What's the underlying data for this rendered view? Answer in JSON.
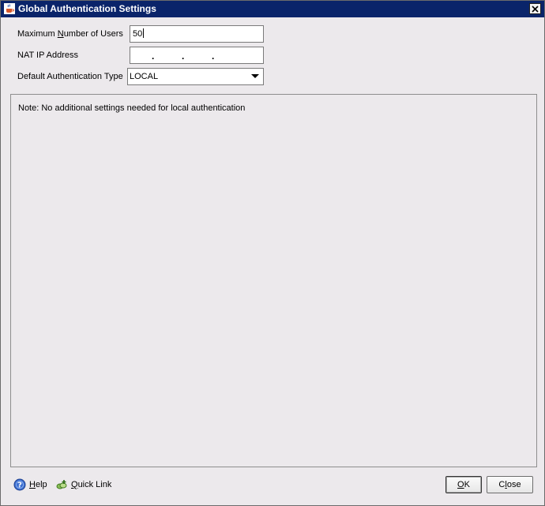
{
  "window": {
    "title": "Global Authentication Settings"
  },
  "form": {
    "max_users": {
      "label_prefix": "Maximum ",
      "label_mnemonic": "N",
      "label_suffix": "umber of Users",
      "value": "50"
    },
    "nat_ip": {
      "label": "NAT IP Address",
      "dots": [
        ".",
        ".",
        "."
      ]
    },
    "auth_type": {
      "label": "Default Authentication Type",
      "selected": "LOCAL"
    }
  },
  "panel": {
    "note": "Note: No additional settings needed for local authentication"
  },
  "footer": {
    "help": {
      "mnemonic": "H",
      "rest": "elp"
    },
    "quick_link": {
      "mnemonic": "Q",
      "rest": "uick Link"
    },
    "ok": {
      "mnemonic": "O",
      "rest": "K"
    },
    "close": {
      "prefix": "C",
      "mnemonic": "l",
      "rest": "ose"
    }
  },
  "icons": {
    "app": "java-cup-icon",
    "close": "close-icon",
    "dropdown": "chevron-down-icon",
    "help": "help-circle-icon",
    "quick_link": "quick-link-icon"
  },
  "colors": {
    "titlebar": "#0a246a",
    "window_bg": "#ece9ec"
  }
}
